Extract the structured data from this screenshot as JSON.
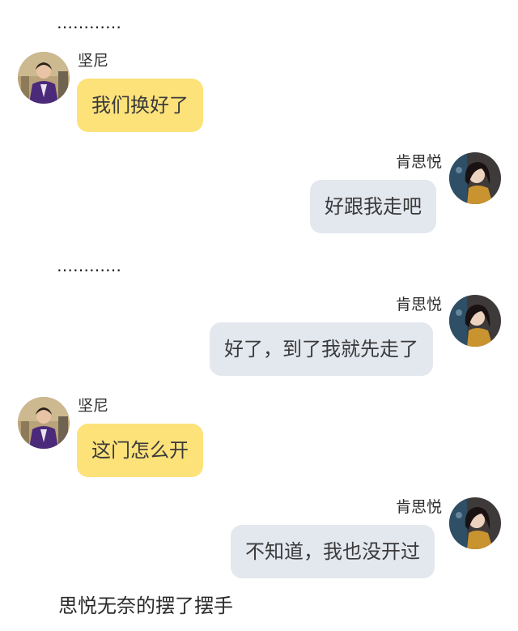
{
  "separators": [
    "…………",
    "…………"
  ],
  "users": {
    "left": {
      "name": "坚尼",
      "avatar_icon": "avatar-man-purple-jacket-icon"
    },
    "right": {
      "name": "肯思悦",
      "avatar_icon": "avatar-woman-dark-hair-icon"
    }
  },
  "messages": [
    {
      "side": "left",
      "sender": "坚尼",
      "text": "我们换好了"
    },
    {
      "side": "right",
      "sender": "肯思悦",
      "text": "好跟我走吧"
    },
    {
      "side": "right",
      "sender": "肯思悦",
      "text": "好了，到了我就先走了"
    },
    {
      "side": "left",
      "sender": "坚尼",
      "text": "这门怎么开"
    },
    {
      "side": "right",
      "sender": "肯思悦",
      "text": "不知道，我也没开过"
    }
  ],
  "narration": "思悦无奈的摆了摆手",
  "colors": {
    "left_bubble": "#fde27a",
    "right_bubble": "#e3e7ee",
    "background": "#ffffff"
  }
}
